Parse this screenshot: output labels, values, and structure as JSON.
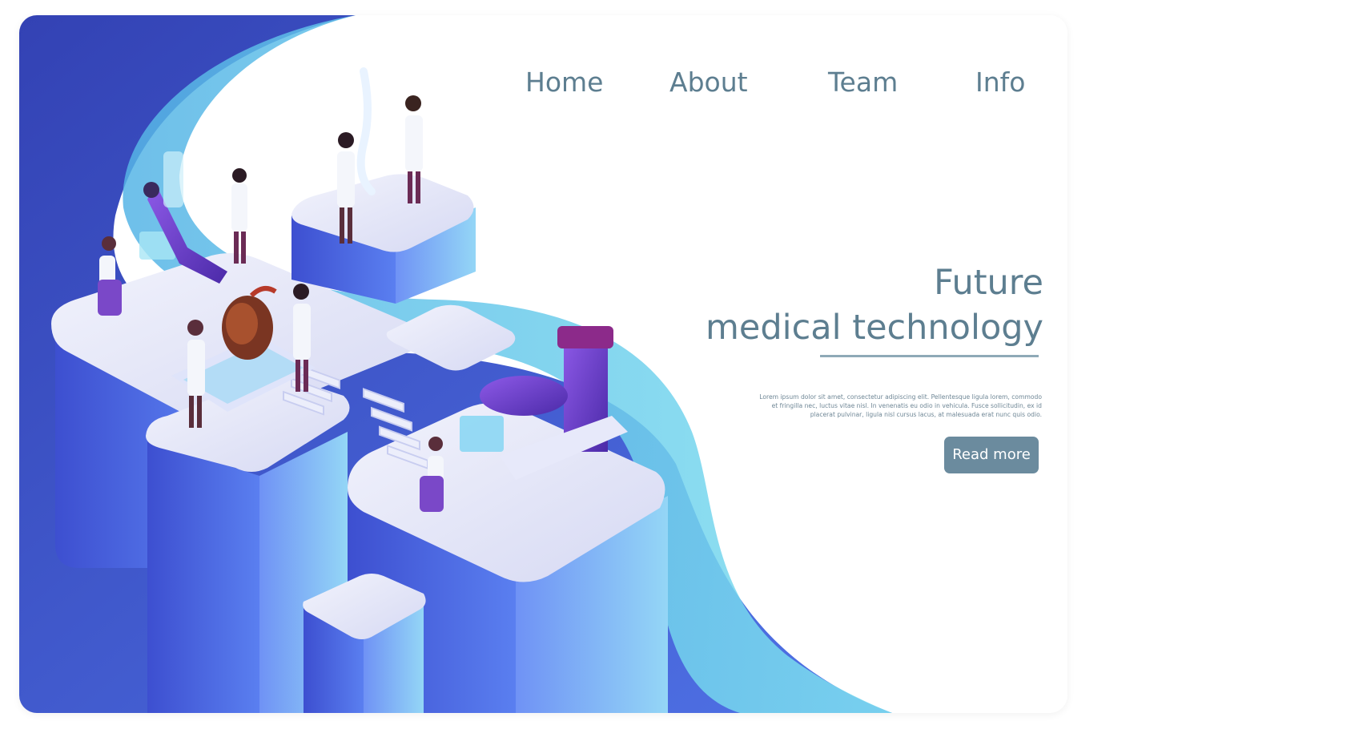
{
  "nav": {
    "items": [
      {
        "label": "Home"
      },
      {
        "label": "About"
      },
      {
        "label": "Team"
      },
      {
        "label": "Info"
      }
    ]
  },
  "hero": {
    "title_line1": "Future",
    "title_line2": "medical technology",
    "body": "Lorem ipsum dolor sit amet, consectetur adipiscing elit. Pellentesque ligula lorem, commodo et fringilla nec, luctus vitae nisl. In venenatis eu odio in vehicula. Fusce sollicitudin, ex id placerat pulvinar, ligula nisl cursus lacus, at malesuada erat nunc quis odio.",
    "button_label": "Read more"
  },
  "colors": {
    "text": "#5d7e90",
    "button": "#6b8b9e",
    "deep_blue": "#3447b8",
    "mid_blue": "#4a6ee0",
    "cyan": "#5fc8e8",
    "lavender": "#dcdff5"
  }
}
